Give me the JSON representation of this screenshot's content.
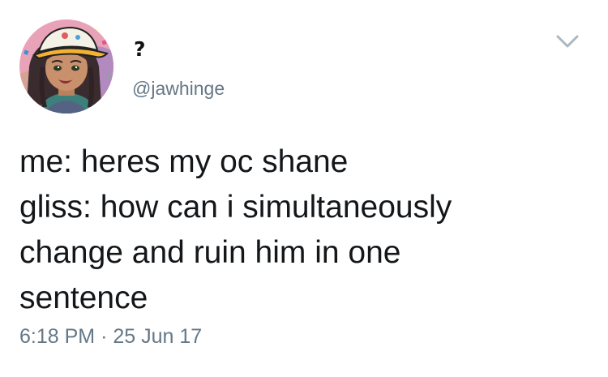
{
  "tweet": {
    "display_name": "?",
    "handle": "@jawhinge",
    "text_lines": [
      "me: heres my oc shane",
      "gliss: how can i simultaneously",
      "change and ruin him in one",
      "sentence"
    ],
    "time": "6:18 PM",
    "separator": "·",
    "date": "25 Jun 17"
  },
  "colors": {
    "text": "#14171a",
    "secondary": "#657786",
    "chevron": "#aab8c2"
  },
  "icons": {
    "menu": "chevron-down-icon",
    "avatar": "avatar-illustration"
  }
}
